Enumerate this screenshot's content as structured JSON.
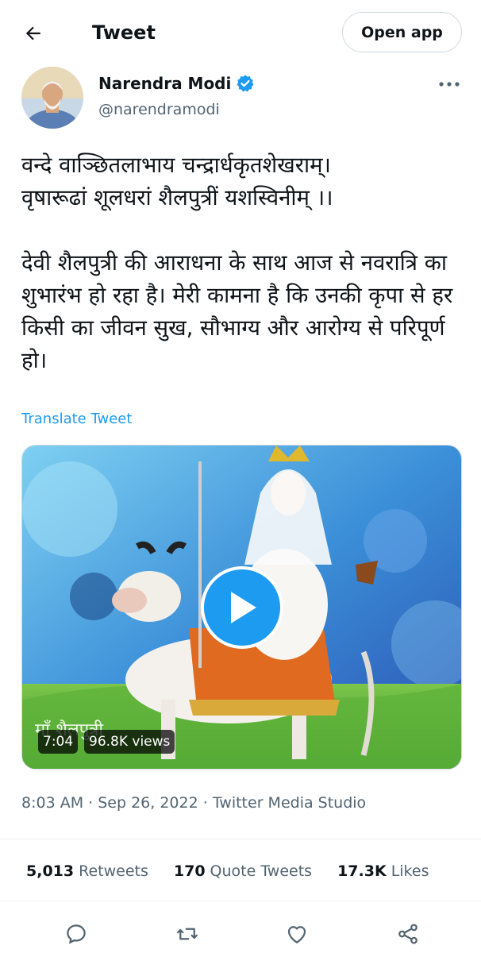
{
  "header": {
    "title": "Tweet",
    "open_app_label": "Open app"
  },
  "author": {
    "display_name": "Narendra Modi",
    "handle": "@narendramodi"
  },
  "tweet": {
    "text": "वन्दे वाञ्छितलाभाय चन्द्रार्धकृतशेखराम्।\nवृषारूढां शूलधरां शैलपुत्रीं यशस्विनीम् ।।\n\nदेवी शैलपुत्री की आराधना के साथ आज से नवरात्रि का शुभारंभ हो रहा है। मेरी कामना है कि उनकी कृपा से हर किसी का जीवन सुख, सौभाग्य और आरोग्य से परिपूर्ण हो।",
    "translate_label": "Translate Tweet"
  },
  "media": {
    "duration": "7:04",
    "views": "96.8K views"
  },
  "meta": {
    "time": "8:03 AM",
    "separator1": " · ",
    "date": "Sep 26, 2022",
    "separator2": " · ",
    "source": "Twitter Media Studio"
  },
  "stats": {
    "retweets_count": "5,013",
    "retweets_label": "Retweets",
    "quotes_count": "170",
    "quotes_label": "Quote Tweets",
    "likes_count": "17.3K",
    "likes_label": "Likes"
  },
  "icons": {
    "back": "back-arrow-icon",
    "verified": "verified-badge-icon",
    "more": "more-horizontal-icon",
    "play": "play-icon",
    "reply": "reply-icon",
    "retweet": "retweet-icon",
    "like": "like-icon",
    "share": "share-icon"
  },
  "colors": {
    "accent": "#1d9bf0",
    "text": "#0f1419",
    "secondary_text": "#536471",
    "border": "#cfd9de"
  }
}
